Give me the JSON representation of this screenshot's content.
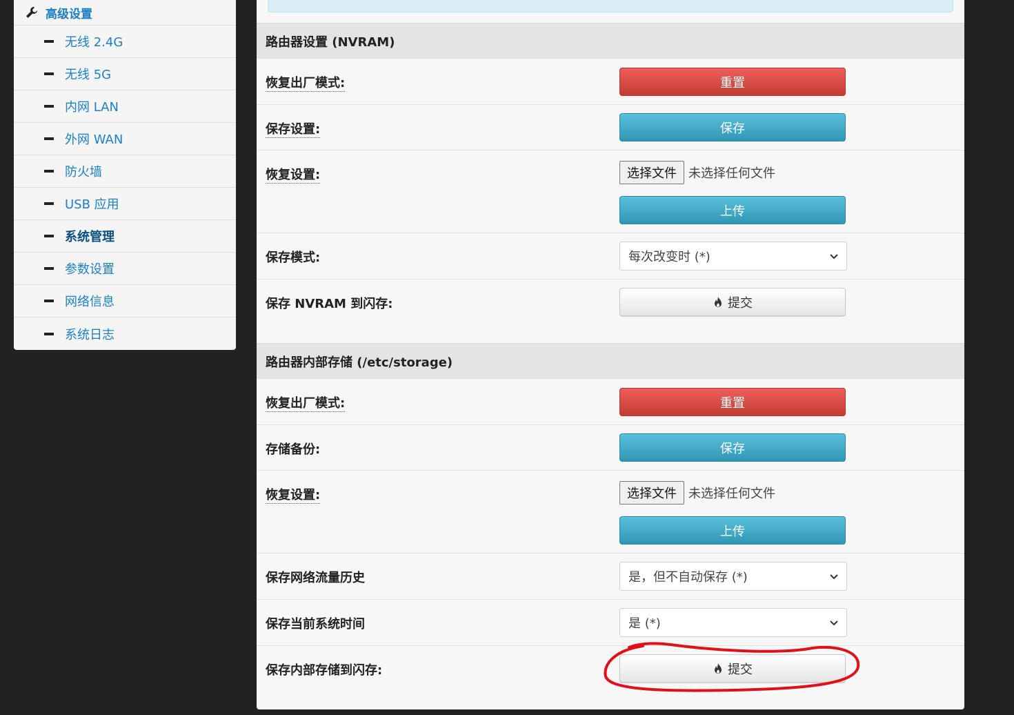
{
  "sidebar": {
    "header": "高级设置",
    "items": [
      {
        "label": "无线 2.4G"
      },
      {
        "label": "无线 5G"
      },
      {
        "label": "内网 LAN"
      },
      {
        "label": "外网 WAN"
      },
      {
        "label": "防火墙"
      },
      {
        "label": "USB 应用"
      },
      {
        "label": "系统管理"
      },
      {
        "label": "参数设置"
      },
      {
        "label": "网络信息"
      },
      {
        "label": "系统日志"
      }
    ],
    "active_item": "系统管理"
  },
  "nvram": {
    "title": "路由器设置 (NVRAM)",
    "factory_label": "恢复出厂模式:",
    "reset_button": "重置",
    "save_label": "保存设置:",
    "save_button": "保存",
    "restore_label": "恢复设置:",
    "choose_file": "选择文件",
    "no_file": "未选择任何文件",
    "upload_button": "上传",
    "save_mode_label": "保存模式:",
    "save_mode_value": "每次改变时 (*)",
    "commit_label": "保存 NVRAM 到闪存:",
    "commit_button": "提交"
  },
  "storage": {
    "title": "路由器内部存储 (/etc/storage)",
    "factory_label": "恢复出厂模式:",
    "reset_button": "重置",
    "backup_label": "存储备份:",
    "save_button": "保存",
    "restore_label": "恢复设置:",
    "choose_file": "选择文件",
    "no_file": "未选择任何文件",
    "upload_button": "上传",
    "traffic_label": "保存网络流量历史",
    "traffic_value": "是，但不自动保存 (*)",
    "time_label": "保存当前系统时间",
    "time_value": "是 (*)",
    "commit_label": "保存内部存储到闪存:",
    "commit_button": "提交"
  },
  "colors": {
    "link_blue": "#1d7fc4",
    "danger_red": "#da4f49",
    "info_blue": "#49afcd",
    "annotation_red": "#e0101a"
  }
}
